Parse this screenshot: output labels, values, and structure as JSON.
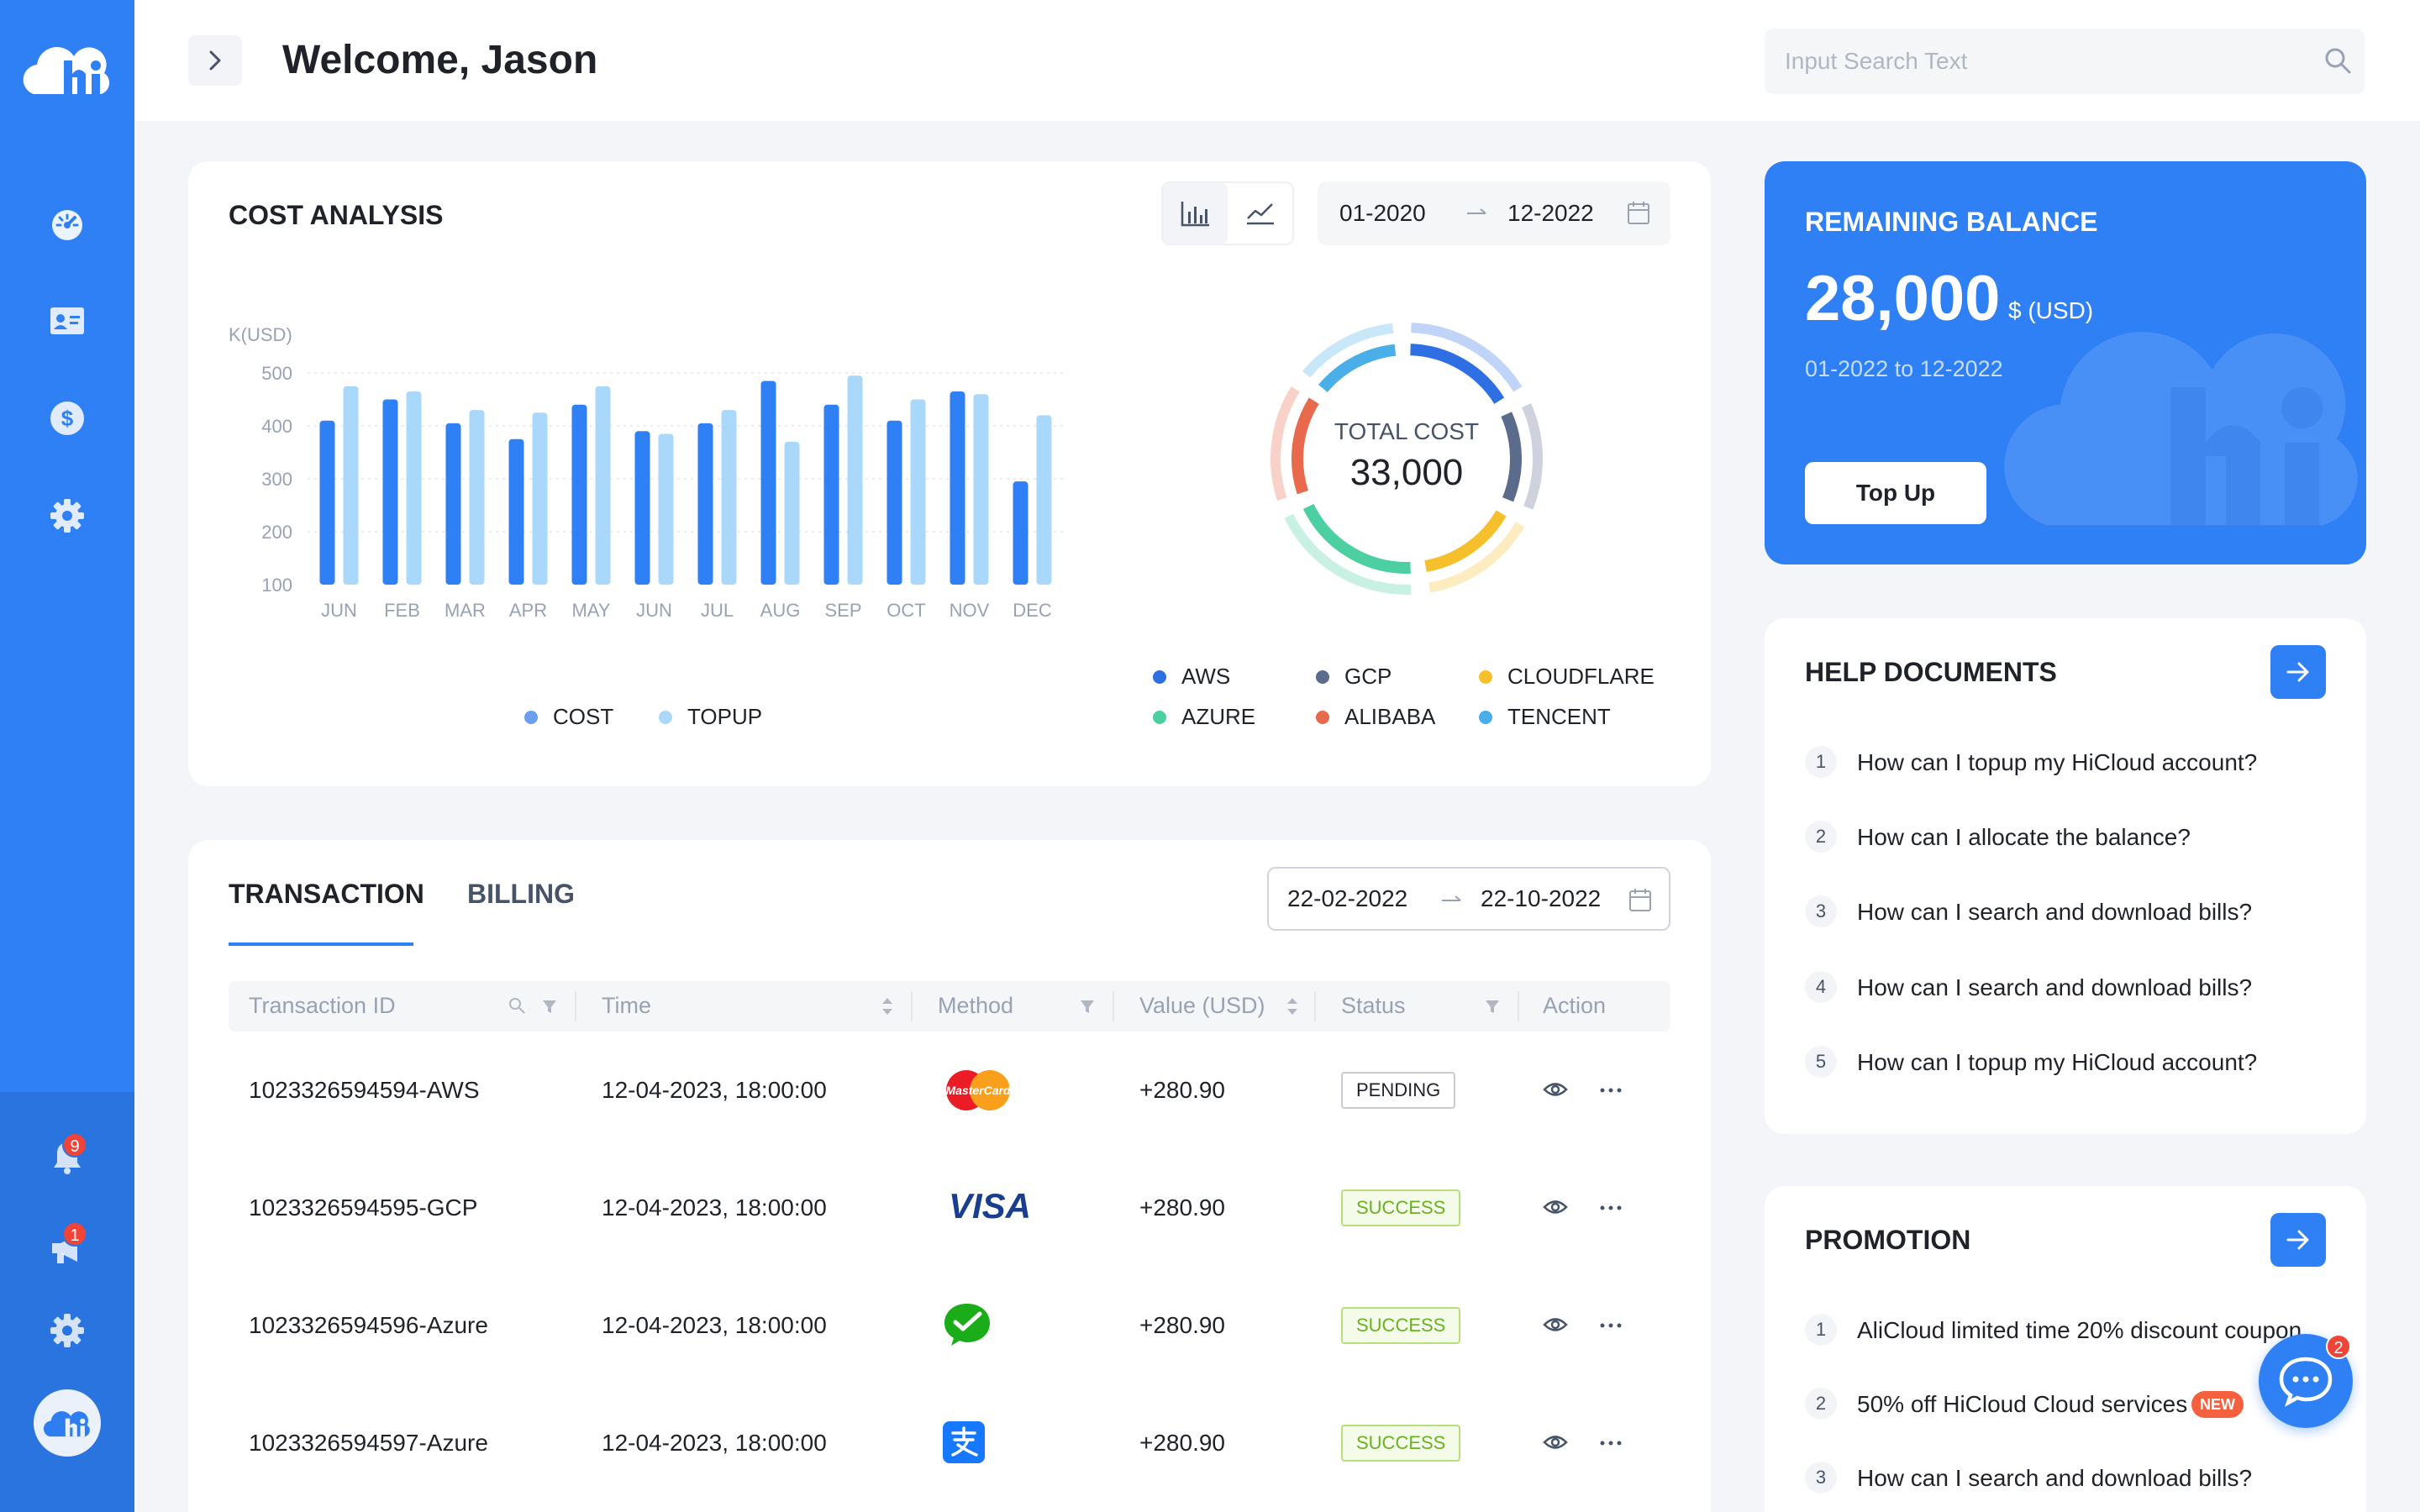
{
  "app": {
    "welcome": "Welcome, Jason"
  },
  "search": {
    "placeholder": "Input Search Text"
  },
  "sidebar": {
    "nav": [
      "dashboard-icon",
      "id-card-icon",
      "dollar-icon",
      "settings-icon"
    ],
    "notifications_count": "9",
    "announcements_count": "1"
  },
  "cost_analysis": {
    "title": "COST ANALYSIS",
    "date_from": "01-2020",
    "date_to": "12-2022",
    "total_label": "TOTAL COST",
    "total_value": "33,000",
    "bar_legend": [
      "COST",
      "TOPUP"
    ],
    "provider_legend": [
      "AWS",
      "GCP",
      "CLOUDFLARE",
      "AZURE",
      "ALIBABA",
      "TENCENT"
    ]
  },
  "chart_data": {
    "type": "bar",
    "ylabel": "K(USD)",
    "ylim": [
      100,
      500
    ],
    "yticks": [
      100,
      200,
      300,
      400,
      500
    ],
    "categories": [
      "JUN",
      "FEB",
      "MAR",
      "APR",
      "MAY",
      "JUN",
      "JUL",
      "AUG",
      "SEP",
      "OCT",
      "NOV",
      "DEC"
    ],
    "series": [
      {
        "name": "COST",
        "values": [
          410,
          450,
          405,
          375,
          440,
          390,
          405,
          485,
          440,
          410,
          465,
          295
        ]
      },
      {
        "name": "TOPUP",
        "values": [
          475,
          465,
          430,
          425,
          475,
          385,
          430,
          370,
          495,
          450,
          460,
          420
        ]
      }
    ],
    "grid": true,
    "legend": "bottom",
    "donut": {
      "center_label": "TOTAL COST",
      "center_value": "33,000",
      "segments": [
        {
          "name": "AWS",
          "color": "#2f6fe4"
        },
        {
          "name": "GCP",
          "color": "#5b6b8c"
        },
        {
          "name": "CLOUDFLARE",
          "color": "#f5c02c"
        },
        {
          "name": "AZURE",
          "color": "#4cd0a2"
        },
        {
          "name": "ALIBABA",
          "color": "#e8694b"
        },
        {
          "name": "TENCENT",
          "color": "#4aaee8"
        }
      ]
    }
  },
  "balance": {
    "title": "REMAINING BALANCE",
    "amount": "28,000",
    "unit": "$ (USD)",
    "period": "01-2022 to 12-2022",
    "topup_label": "Top Up"
  },
  "help": {
    "title": "HELP DOCUMENTS",
    "items": [
      {
        "num": "1",
        "text": "How can I topup my HiCloud account?"
      },
      {
        "num": "2",
        "text": "How can I allocate the balance?"
      },
      {
        "num": "3",
        "text": "How can I search and download bills?"
      },
      {
        "num": "4",
        "text": "How can I search and download bills?"
      },
      {
        "num": "5",
        "text": "How can I topup my HiCloud account?"
      }
    ]
  },
  "promotion": {
    "title": "PROMOTION",
    "items": [
      {
        "num": "1",
        "text": "AliCloud limited time 20% discount coupon"
      },
      {
        "num": "2",
        "text": "50% off HiCloud Cloud services",
        "tag": "NEW"
      },
      {
        "num": "3",
        "text": "How can I search and download bills?"
      }
    ],
    "chat_badge": "2"
  },
  "transactions": {
    "tabs": [
      "TRANSACTION",
      "BILLING"
    ],
    "date_from": "22-02-2022",
    "date_to": "22-10-2022",
    "columns": [
      "Transaction ID",
      "Time",
      "Method",
      "Value (USD)",
      "Status",
      "Action"
    ],
    "rows": [
      {
        "id": "1023326594594-AWS",
        "time": "12-04-2023, 18:00:00",
        "method": "mastercard-icon",
        "method_label": "MasterCard",
        "value": "+280.90",
        "status": "PENDING"
      },
      {
        "id": "1023326594595-GCP",
        "time": "12-04-2023, 18:00:00",
        "method": "visa-icon",
        "method_label": "VISA",
        "value": "+280.90",
        "status": "SUCCESS"
      },
      {
        "id": "1023326594596-Azure",
        "time": "12-04-2023, 18:00:00",
        "method": "wechat-pay-icon",
        "value": "+280.90",
        "status": "SUCCESS"
      },
      {
        "id": "1023326594597-Azure",
        "time": "12-04-2023, 18:00:00",
        "method": "alipay-icon",
        "value": "+280.90",
        "status": "SUCCESS"
      }
    ]
  },
  "colors": {
    "primary": "#2f80f5",
    "cost_bar": "#2f80f5",
    "topup_bar": "#a9d8fb",
    "success": "#6ab023"
  }
}
